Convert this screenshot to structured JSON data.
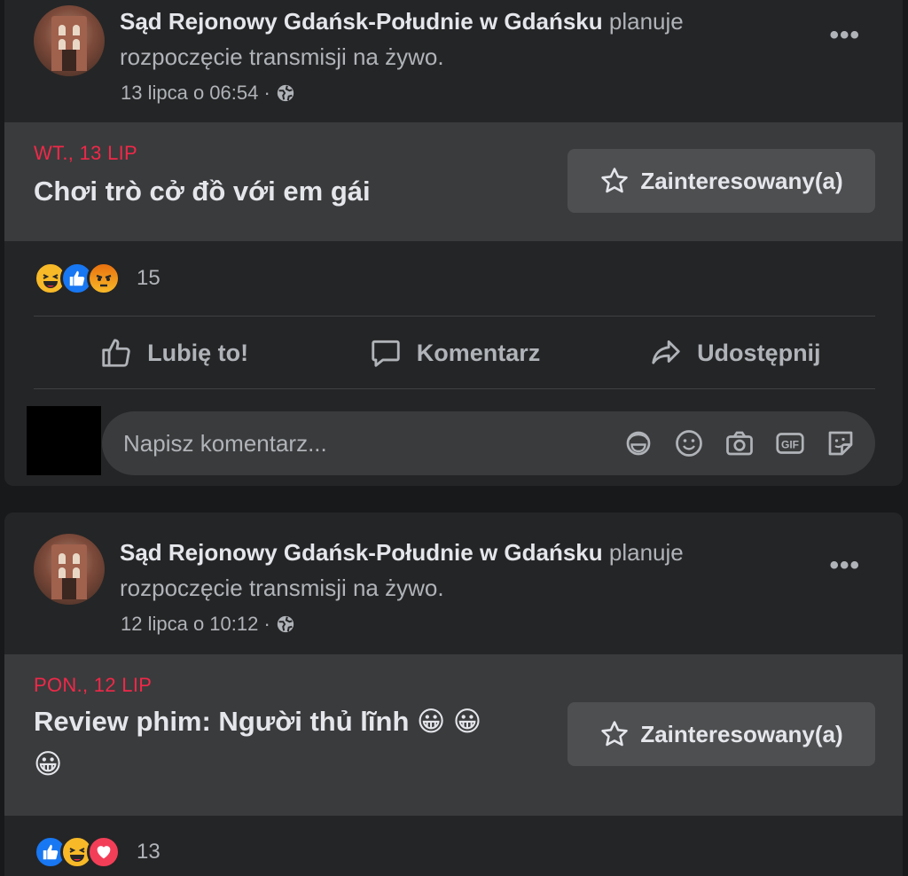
{
  "posts": [
    {
      "page_name": "Sąd Rejonowy Gdańsk-Południe w Gdańsku",
      "headline_rest_1": "planuje",
      "headline_rest_2": "rozpoczęcie transmisji na żywo.",
      "timestamp": "13 lipca o 06:54 ·",
      "event_date": "WT., 13 LIP",
      "event_title": "Chơi trò cở đồ với em gái",
      "interested_label": "Zainteresowany(a)",
      "reactions": [
        "haha",
        "like",
        "angry"
      ],
      "reaction_count": "15",
      "actions": {
        "like": "Lubię to!",
        "comment": "Komentarz",
        "share": "Udostępnij"
      },
      "comment_placeholder": "Napisz komentarz..."
    },
    {
      "page_name": "Sąd Rejonowy Gdańsk-Południe w Gdańsku",
      "headline_rest_1": "planuje",
      "headline_rest_2": "rozpoczęcie transmisji na żywo.",
      "timestamp": "12 lipca o 10:12 ·",
      "event_date": "PON., 12 LIP",
      "event_title_line1": "Review phim: Người thủ lĩnh 😀 😀",
      "event_title_line2": "😀",
      "interested_label": "Zainteresowany(a)",
      "reactions": [
        "like",
        "haha",
        "love"
      ],
      "reaction_count": "13"
    }
  ],
  "icons": {
    "more": "more-options-icon",
    "globe": "globe-icon",
    "star": "star-icon",
    "like": "thumbs-up-icon",
    "comment": "comment-bubble-icon",
    "share": "share-arrow-icon",
    "composer_icons": [
      "avatar-sticker-icon",
      "emoji-icon",
      "camera-icon",
      "gif-icon",
      "sticker-icon"
    ]
  },
  "colors": {
    "background": "#18191a",
    "card": "#242526",
    "event_bg": "#3a3b3c",
    "date_red": "#f02849",
    "like_blue": "#1877f2"
  }
}
